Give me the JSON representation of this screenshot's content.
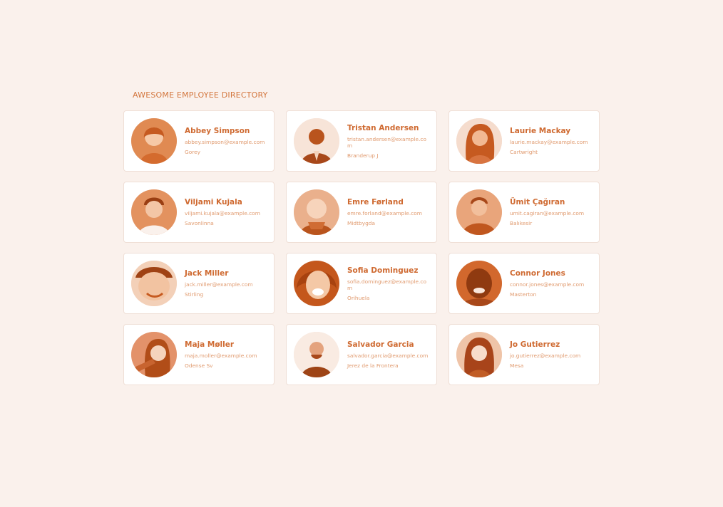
{
  "directory_title": "AWESOME EMPLOYEE DIRECTORY",
  "colors": {
    "background": "#faf1ec",
    "accent": "#cf6a31",
    "muted": "#e09a6e",
    "card": "#ffffff"
  },
  "employees": [
    {
      "name": "Abbey Simpson",
      "email": "abbey.simpson@example.com",
      "city": "Gorey",
      "avatar": "photo-icon"
    },
    {
      "name": "Tristan Andersen",
      "email": "tristan.andersen@example.com",
      "city": "Branderup J",
      "avatar": "photo-icon"
    },
    {
      "name": "Laurie Mackay",
      "email": "laurie.mackay@example.com",
      "city": "Cartwright",
      "avatar": "photo-icon"
    },
    {
      "name": "Viljami Kujala",
      "email": "viljami.kujala@example.com",
      "city": "Savonlinna",
      "avatar": "photo-icon"
    },
    {
      "name": "Emre Førland",
      "email": "emre.forland@example.com",
      "city": "Midtbygda",
      "avatar": "photo-icon"
    },
    {
      "name": "Ümit Çağıran",
      "email": "umit.cagiran@example.com",
      "city": "Balıkesir",
      "avatar": "photo-icon"
    },
    {
      "name": "Jack Miller",
      "email": "jack.miller@example.com",
      "city": "Stirling",
      "avatar": "photo-icon"
    },
    {
      "name": "Sofia Dominguez",
      "email": "sofia.dominguez@example.com",
      "city": "Orihuela",
      "avatar": "photo-icon"
    },
    {
      "name": "Connor Jones",
      "email": "connor.jones@example.com",
      "city": "Masterton",
      "avatar": "photo-icon"
    },
    {
      "name": "Maja Møller",
      "email": "maja.moller@example.com",
      "city": "Odense Sv",
      "avatar": "photo-icon"
    },
    {
      "name": "Salvador Garcia",
      "email": "salvador.garcia@example.com",
      "city": "Jerez de la Frontera",
      "avatar": "photo-icon"
    },
    {
      "name": "Jo Gutierrez",
      "email": "jo.gutierrez@example.com",
      "city": "Mesa",
      "avatar": "photo-icon"
    }
  ]
}
